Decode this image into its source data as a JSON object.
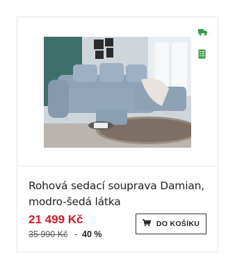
{
  "product": {
    "title": "Rohová sedací souprava Damian, modro-šedá látka",
    "price": "21 499 Kč",
    "old_price": "35 990 Kč",
    "separator": "-",
    "discount": "40 %",
    "cart_button_label": "DO KOŠÍKU",
    "image_alt": "Rohová sedací souprava Damian"
  },
  "icons": {
    "delivery": "truck-icon",
    "specs": "spec-sheet-icon",
    "cart": "cart-icon"
  },
  "colors": {
    "price": "#d6182a",
    "icon_green": "#2ea043",
    "border": "#e3e3e3"
  }
}
